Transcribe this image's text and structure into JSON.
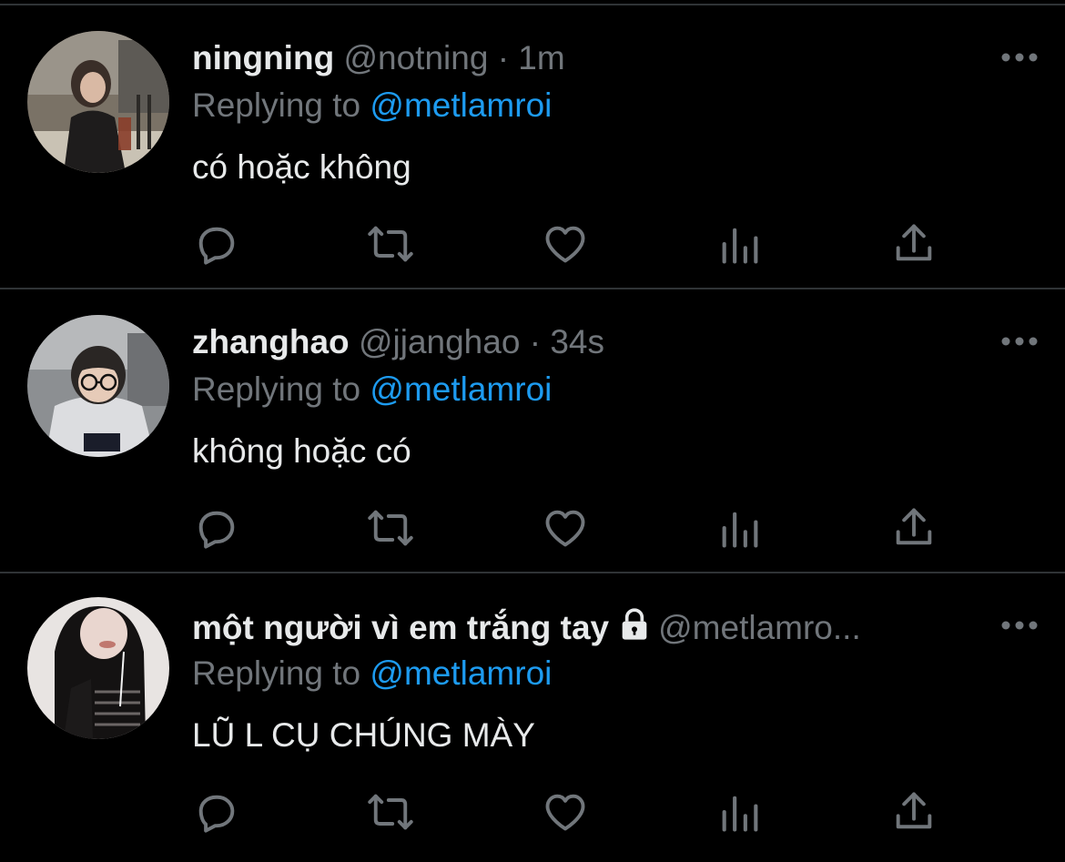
{
  "tweets": [
    {
      "display_name": "ningning",
      "handle": "@notning",
      "separator": "·",
      "time": "1m",
      "replying_prefix": "Replying to",
      "replying_to": "@metlamroi",
      "text": "có hoặc không",
      "locked": false,
      "avatar_icon": "avatar-photo-woman-cafe"
    },
    {
      "display_name": "zhanghao",
      "handle": "@jjanghao",
      "separator": "·",
      "time": "34s",
      "replying_prefix": "Replying to",
      "replying_to": "@metlamroi",
      "text": "không hoặc có",
      "locked": false,
      "avatar_icon": "avatar-photo-man-glasses"
    },
    {
      "display_name": "một người vì em trắng tay",
      "handle": "@metlamro...",
      "separator": "",
      "time": "",
      "replying_prefix": "Replying to",
      "replying_to": "@metlamroi",
      "text": "LŨ L CỤ CHÚNG MÀY",
      "locked": true,
      "avatar_icon": "avatar-photo-woman-long-hair"
    }
  ],
  "action_icons": [
    "reply-icon",
    "retweet-icon",
    "like-icon",
    "analytics-icon",
    "share-icon"
  ],
  "more_icon": "more-dots-icon",
  "colors": {
    "background": "#000000",
    "primary_text": "#e7e9ea",
    "secondary_text": "#71767b",
    "accent": "#1d9bf0",
    "divider": "#2f3336"
  }
}
